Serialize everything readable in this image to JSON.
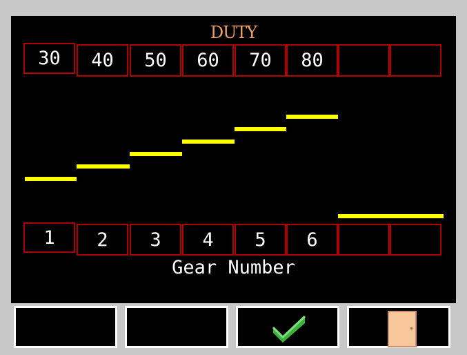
{
  "title": "DUTY",
  "duty_values": [
    "30",
    "40",
    "50",
    "60",
    "70",
    "80",
    "",
    ""
  ],
  "gear_numbers": [
    "1",
    "2",
    "3",
    "4",
    "5",
    "6",
    "",
    ""
  ],
  "caption": "Gear Number",
  "softkeys": [
    {
      "icon": "",
      "label": ""
    },
    {
      "icon": "",
      "label": ""
    },
    {
      "icon": "check-icon"
    },
    {
      "icon": "door-icon"
    }
  ],
  "colors": {
    "background": "#000000",
    "frame": "#c8c8c8",
    "title": "#f0a060",
    "cell_border": "#b00000",
    "bars": "#ffff00",
    "text": "#ffffff",
    "check": "#3cb43c",
    "door": "#f8c89c"
  },
  "selected_column": 1
}
